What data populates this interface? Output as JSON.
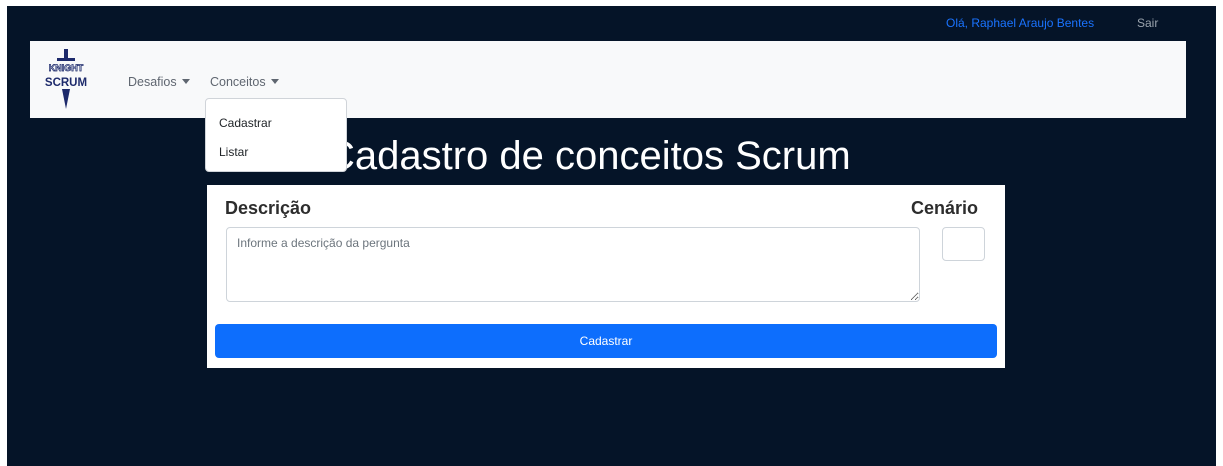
{
  "topbar": {
    "greeting": "Olá, Raphael Araujo Bentes",
    "logout_label": "Sair"
  },
  "navbar": {
    "logo_text": "KNIGHT SCRUM",
    "items": [
      {
        "label": "Desafios"
      },
      {
        "label": "Conceitos"
      }
    ],
    "dropdown": {
      "items": [
        {
          "label": "Cadastrar"
        },
        {
          "label": "Listar"
        }
      ]
    }
  },
  "page": {
    "title": "Cadastro de conceitos Scrum"
  },
  "form": {
    "descricao_label": "Descrição",
    "descricao_value": "",
    "descricao_placeholder": "Informe a descrição da pergunta",
    "cenario_label": "Cenário",
    "cenario_value": "",
    "submit_label": "Cadastrar"
  },
  "colors": {
    "page_background": "#051428",
    "navbar_background": "#f8f9fa",
    "accent": "#0d6efd",
    "greeting_link": "#1a73ff"
  }
}
